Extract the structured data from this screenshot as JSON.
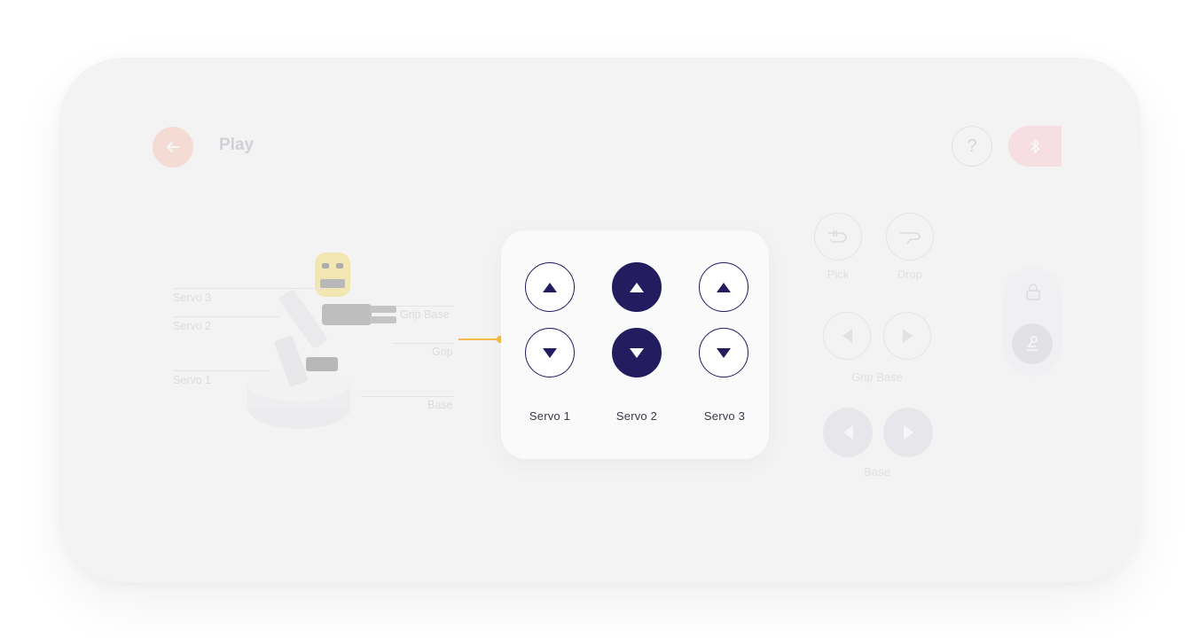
{
  "header": {
    "title": "Play",
    "back_icon": "arrow-left-icon",
    "help_label": "?",
    "bluetooth_icon": "bluetooth-icon"
  },
  "robot_labels": {
    "servo3": "Servo 3",
    "servo2": "Servo 2",
    "servo1": "Servo 1",
    "grip_base": "Grip Base",
    "grip": "Grip",
    "base": "Base"
  },
  "right_controls": {
    "pick": "Pick",
    "drop": "Drop",
    "grip_base": "Grip Base",
    "base": "Base"
  },
  "servo_panel": {
    "servos": [
      {
        "label": "Servo 1",
        "active": false
      },
      {
        "label": "Servo 2",
        "active": true
      },
      {
        "label": "Servo 3",
        "active": false
      }
    ]
  },
  "colors": {
    "accent": "#231c5f",
    "connector": "#f6b94a",
    "back_button": "#f7b9a2",
    "bluetooth_button": "#fbbdc6"
  }
}
